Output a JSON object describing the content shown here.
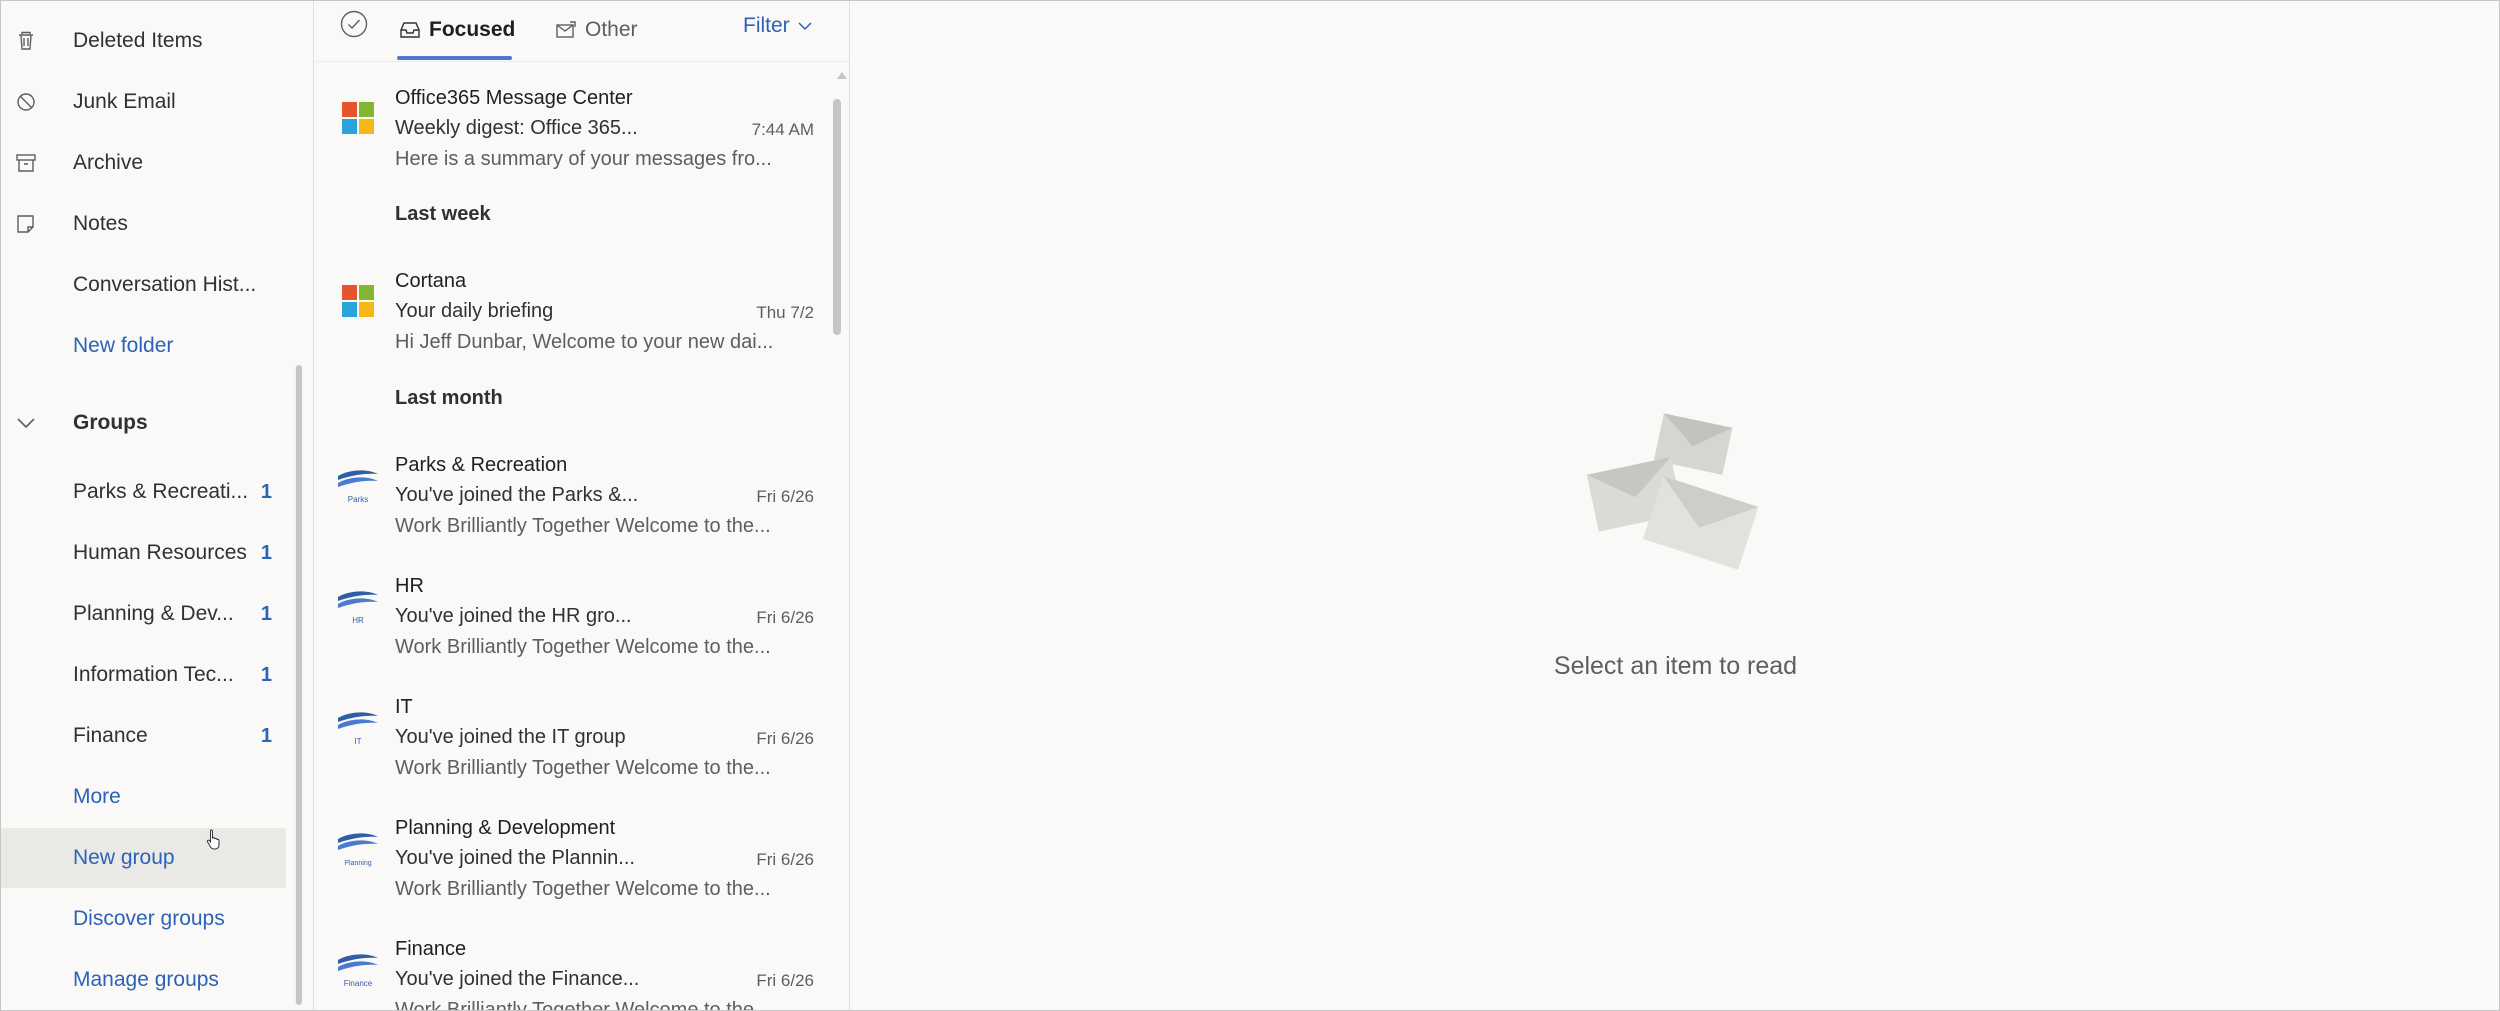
{
  "sidebar": {
    "folders": [
      {
        "label": "Deleted Items",
        "icon": "trash-icon"
      },
      {
        "label": "Junk Email",
        "icon": "blocked-icon"
      },
      {
        "label": "Archive",
        "icon": "archive-icon"
      },
      {
        "label": "Notes",
        "icon": "note-icon"
      },
      {
        "label": "Conversation Hist...",
        "icon": ""
      }
    ],
    "new_folder": "New folder",
    "groups_header": "Groups",
    "groups": [
      {
        "label": "Parks & Recreati...",
        "count": "1"
      },
      {
        "label": "Human Resources",
        "count": "1"
      },
      {
        "label": "Planning & Dev...",
        "count": "1"
      },
      {
        "label": "Information Tec...",
        "count": "1"
      },
      {
        "label": "Finance",
        "count": "1"
      }
    ],
    "more": "More",
    "new_group": "New group",
    "discover_groups": "Discover groups",
    "manage_groups": "Manage groups"
  },
  "list": {
    "tabs": {
      "focused": "Focused",
      "other": "Other"
    },
    "filter": "Filter",
    "messages_top": {
      "sender": "Office365 Message Center",
      "subject": "Weekly digest: Office 365...",
      "date": "7:44 AM",
      "preview": "Here is a summary of your messages fro..."
    },
    "sections": {
      "last_week": "Last week",
      "last_month": "Last month"
    },
    "cortana": {
      "sender": "Cortana",
      "subject": "Your daily briefing",
      "date": "Thu 7/2",
      "preview": "Hi Jeff Dunbar, Welcome to your new dai..."
    },
    "groups_msgs": [
      {
        "sender": "Parks & Recreation",
        "subject": "You've joined the Parks &...",
        "date": "Fri 6/26",
        "preview": "Work Brilliantly Together Welcome to the...",
        "badge": "Parks"
      },
      {
        "sender": "HR",
        "subject": "You've joined the HR gro...",
        "date": "Fri 6/26",
        "preview": "Work Brilliantly Together Welcome to the...",
        "badge": "HR"
      },
      {
        "sender": "IT",
        "subject": "You've joined the IT group",
        "date": "Fri 6/26",
        "preview": "Work Brilliantly Together Welcome to the...",
        "badge": "IT"
      },
      {
        "sender": "Planning & Development",
        "subject": "You've joined the Plannin...",
        "date": "Fri 6/26",
        "preview": "Work Brilliantly Together Welcome to the...",
        "badge": "Planning"
      },
      {
        "sender": "Finance",
        "subject": "You've joined the Finance...",
        "date": "Fri 6/26",
        "preview": "Work Brilliantly Together Welcome to the...",
        "badge": "Finance"
      }
    ]
  },
  "reading_pane": {
    "empty_text": "Select an item to read"
  },
  "colors": {
    "accent": "#2b63b6",
    "tab_underline": "#4a7bd0",
    "background": "#faf9f8"
  }
}
